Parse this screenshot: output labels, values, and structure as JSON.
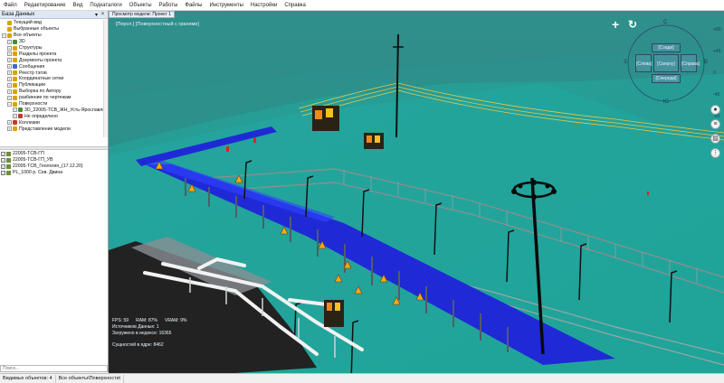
{
  "menubar": {
    "items": [
      "Файл",
      "Редактирование",
      "Вид",
      "Подкаталоги",
      "Объекты",
      "Работы",
      "Файлы",
      "Инструменты",
      "Настройки",
      "Справка"
    ]
  },
  "left_panel": {
    "title": "База Данных",
    "pin_glyph": "▾",
    "close_glyph": "×",
    "tree": [
      {
        "label": "Текущий вид",
        "indent": 0,
        "expander": "",
        "icon": "#d9a300"
      },
      {
        "label": "Выбранные объекты",
        "indent": 0,
        "expander": "",
        "icon": "#d9a300"
      },
      {
        "label": "Все объекты",
        "indent": 0,
        "expander": "−",
        "icon": "#d9a300"
      },
      {
        "label": "3D",
        "indent": 1,
        "expander": "+",
        "icon": "#4a8a3a"
      },
      {
        "label": "Структуры",
        "indent": 1,
        "expander": "+",
        "icon": "#d9a300"
      },
      {
        "label": "Разделы проекта",
        "indent": 1,
        "expander": "+",
        "icon": "#d9a300"
      },
      {
        "label": "Документы проекта",
        "indent": 1,
        "expander": "+",
        "icon": "#d9a300"
      },
      {
        "label": "Сообщения",
        "indent": 1,
        "expander": "+",
        "icon": "#3b6bbf"
      },
      {
        "label": "Реестр тэгов",
        "indent": 1,
        "expander": "+",
        "icon": "#d9a300"
      },
      {
        "label": "Координатные сетки",
        "indent": 1,
        "expander": "+",
        "icon": "#d9a300"
      },
      {
        "label": "Публикации",
        "indent": 1,
        "expander": "+",
        "icon": "#d9a300"
      },
      {
        "label": "Выборка по Автору",
        "indent": 1,
        "expander": "+",
        "icon": "#d9a300"
      },
      {
        "label": "разбиение по чертежам",
        "indent": 1,
        "expander": "+",
        "icon": "#d9a300"
      },
      {
        "label": "Поверхности",
        "indent": 1,
        "expander": "−",
        "icon": "#d9a300"
      },
      {
        "label": "3D_22005-ТСВ_ЖН_Усть-Ярославль...",
        "indent": 2,
        "expander": "+",
        "icon": "#4a8a3a"
      },
      {
        "label": "Не определено",
        "indent": 2,
        "expander": "+",
        "icon": "#c23a2a"
      },
      {
        "label": "Коллизии",
        "indent": 1,
        "expander": "+",
        "icon": "#c23a2a"
      },
      {
        "label": "Представление модели",
        "indent": 1,
        "expander": "+",
        "icon": "#d9a300"
      }
    ],
    "layers": [
      {
        "label": "22005-ТСВ-ГП",
        "checked": true
      },
      {
        "label": "22005-ТСВ-ГП_УВ",
        "checked": true
      },
      {
        "label": "22005-ТСВ_Геология_(17.12.20)",
        "checked": true
      },
      {
        "label": "PL_1000 р. Сев. Двина",
        "checked": true
      }
    ],
    "search_placeholder": "Поиск..."
  },
  "viewport": {
    "tab_label": "Просмотр модели: Проект 1",
    "caption": "[Персп.] [Поверхностный с гранями]",
    "stats": {
      "fps": "FPS: 59",
      "ram": "RAM: 87%",
      "vram": "VRAM: 9%",
      "sources": "Источников Данных: 1",
      "loaded": "Загружено в индексе: 16365",
      "entities": "Сущностей в ядре: 8462"
    },
    "nav": {
      "plus_glyph": "+",
      "rotate_glyph": "↻"
    },
    "viewcube": {
      "north": "С",
      "south": "Ю",
      "west": "З",
      "east": "В",
      "back": "[Сзади]",
      "left": "[Слева]",
      "top": "[Сверху]",
      "right": "[Справа]",
      "front": "[Спереди]"
    },
    "ruler": [
      "+90",
      "+45",
      "0",
      "-45",
      "-90"
    ],
    "side_tools": [
      {
        "name": "pin-icon",
        "glyph": "●"
      },
      {
        "name": "layers-icon",
        "glyph": "≡"
      },
      {
        "name": "hatch-icon",
        "glyph": "▨"
      },
      {
        "name": "more-icon",
        "glyph": "⋮"
      }
    ],
    "colors": {
      "water": "#2f8f8a",
      "ground": "#2aa7a0",
      "road": "#1f2ad6",
      "fence": "#7f8c8c",
      "pipe": "#f2f2f2",
      "warning": "#f4a81c",
      "building": "#222222"
    }
  },
  "statusbar": {
    "visible_objects": "Видимых объектов: 4",
    "filter": "Все объекты\\Поверхности\\"
  }
}
